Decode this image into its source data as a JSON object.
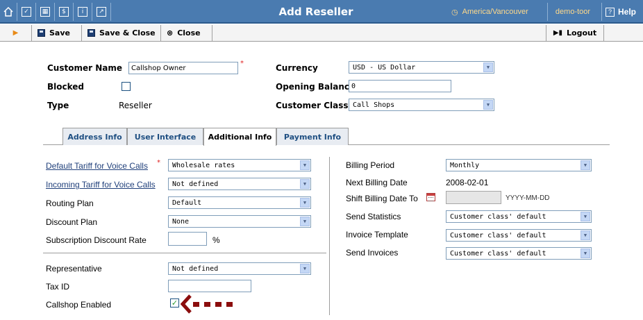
{
  "header": {
    "title": "Add Reseller",
    "timezone": "America/Vancouver",
    "user": "demo-toor",
    "help_label": "Help",
    "nav_icons": [
      "home-icon",
      "checkbox-icon",
      "grid-icon",
      "dollar-icon",
      "info-icon",
      "chart-icon"
    ]
  },
  "toolbar": {
    "save_label": "Save",
    "save_close_label": "Save & Close",
    "close_label": "Close",
    "logout_label": "Logout"
  },
  "form": {
    "customer_name_label": "Customer Name",
    "customer_name_value": "Callshop Owner",
    "blocked_label": "Blocked",
    "type_label": "Type",
    "type_value": "Reseller",
    "currency_label": "Currency",
    "currency_value": "USD - US Dollar",
    "opening_balance_label": "Opening Balance",
    "opening_balance_value": "0",
    "customer_class_label": "Customer Class",
    "customer_class_value": "Call Shops"
  },
  "tabs": [
    {
      "label": "Address Info",
      "active": false
    },
    {
      "label": "User Interface",
      "active": false
    },
    {
      "label": "Additional Info",
      "active": true
    },
    {
      "label": "Payment Info",
      "active": false
    }
  ],
  "additional": {
    "default_tariff_label": "Default Tariff for Voice Calls",
    "default_tariff_value": "Wholesale rates",
    "incoming_tariff_label": "Incoming Tariff for Voice Calls",
    "incoming_tariff_value": "Not defined",
    "routing_plan_label": "Routing Plan",
    "routing_plan_value": "Default",
    "discount_plan_label": "Discount Plan",
    "discount_plan_value": "None",
    "subscription_discount_label": "Subscription Discount Rate",
    "subscription_discount_value": "",
    "percent_sign": "%",
    "representative_label": "Representative",
    "representative_value": "Not defined",
    "tax_id_label": "Tax ID",
    "tax_id_value": "",
    "callshop_label": "Callshop Enabled",
    "callshop_checked": true,
    "billing_period_label": "Billing Period",
    "billing_period_value": "Monthly",
    "next_billing_label": "Next Billing Date",
    "next_billing_value": "2008-02-01",
    "shift_billing_label": "Shift Billing Date To",
    "shift_billing_value": "",
    "date_format_hint": "YYYY-MM-DD",
    "send_statistics_label": "Send Statistics",
    "send_statistics_value": "Customer class' default",
    "invoice_template_label": "Invoice Template",
    "invoice_template_value": "Customer class' default",
    "send_invoices_label": "Send Invoices",
    "send_invoices_value": "Customer class' default"
  },
  "colors": {
    "titlebar": "#4a7bb0",
    "accent_link": "#1f3f7a",
    "highlight_text": "#ffd98a",
    "arrow_annotation": "#8b0d0d"
  }
}
